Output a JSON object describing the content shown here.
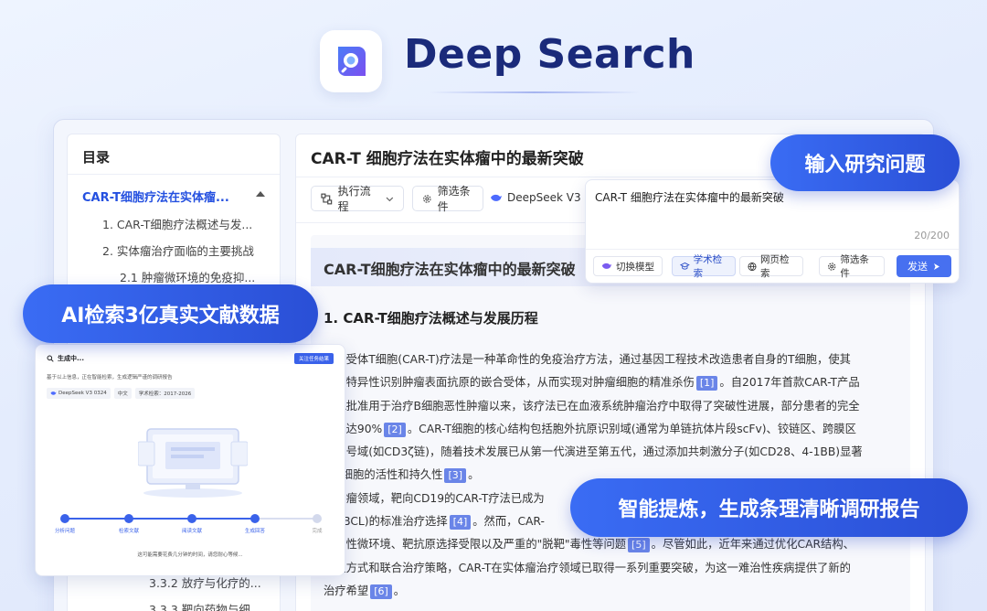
{
  "header": {
    "title": "Deep Search"
  },
  "toc": {
    "heading": "目录",
    "active": "CAR-T细胞疗法在实体瘤...",
    "items": [
      "1.   CAR-T细胞疗法概述与发...",
      "2.   实体瘤治疗面临的主要挑战",
      "2.1   肿瘤微环境的免疫抑..."
    ],
    "bottom_items": [
      "3.3.2 放疗与化疗的...",
      "3.3.3 靶向药物与细..."
    ]
  },
  "content": {
    "title": "CAR-T 细胞疗法在实体瘤中的最新突破",
    "toolbar": {
      "flow": "执行流程",
      "filter": "筛选条件",
      "model": "DeepSeek V3 03"
    },
    "report_title": "CAR-T细胞疗法在实体瘤中的最新突破",
    "section_heading": "1. CAR-T细胞疗法概述与发展历程",
    "para": [
      {
        "t": "抗原受体T细胞(CAR-T)疗法是一种革命性的免疫治疗方法，通过基因工程技术改造患者自身的T细胞，使其"
      },
      {
        "t": "能够特异性识别肿瘤表面抗原的嵌合受体，从而实现对肿瘤细胞的精准杀伤",
        "c": "[1]",
        "t2": "。自2017年首款CAR-T产品"
      },
      {
        "t": "FDA批准用于治疗B细胞恶性肿瘤以来，该疗法已在血液系统肿瘤治疗中取得了突破性进展，部分患者的完全"
      },
      {
        "t": "率高达90%",
        "c": "[2]",
        "t2": "。CAR-T细胞的核心结构包括胞外抗原识别域(通常为单链抗体片段scFv)、铰链区、跨膜区"
      },
      {
        "t": "内信号域(如CD3ζ链)，随着技术发展已从第一代演进至第五代，通过添加共刺激分子(如CD28、4-1BB)显著"
      },
      {
        "t": "了T细胞的活性和持久性",
        "c": "[3]",
        "t2": "。"
      },
      {
        "t": "液肿瘤领域，靶向CD19的CAR-T疗法已成为"
      },
      {
        "t": "(DLBCL)的标准治疗选择",
        "c": "[4]",
        "t2": "。然而，CAR-"
      },
      {
        "t": "抑制性微环境、靶抗原选择受限以及严重的\"脱靶\"毒性等问题",
        "c": "[5]",
        "t2": "。尽管如此，近年来通过优化CAR结构、"
      },
      {
        "t": "递送方式和联合治疗策略，CAR-T在实体瘤治疗领域已取得一系列重要突破，为这一难治性疾病提供了新的"
      },
      {
        "t": "治疗希望",
        "c": "[6]",
        "t2": "。"
      }
    ]
  },
  "chat": {
    "question": "CAR-T 细胞疗法在实体瘤中的最新突破",
    "count": "20/200",
    "chips": [
      "切换模型",
      "学术检索",
      "网页检索",
      "筛选条件"
    ],
    "send": "发送"
  },
  "pills": {
    "p1": "输入研究问题",
    "p2": "AI检索3亿真实文献数据",
    "p3": "智能提炼，生成条理清晰调研报告"
  },
  "card": {
    "status": "生成中...",
    "button": "关注任务结果",
    "desc": "基于以上信息，正在智能检索，生成逻辑严谨的调研报告",
    "tags": [
      "DeepSeek V3 0324",
      "中文",
      "学术检索：2017-2026"
    ],
    "steps": [
      "分析问题",
      "检索文献",
      "阅读文献",
      "生成回答",
      "完成"
    ],
    "footer": "这可能需要花费几分钟的时间，请您耐心等候..."
  },
  "colors": {
    "accent": "#3a62ea",
    "brand_dark": "#1a2a7a",
    "cite": "#6a85e8"
  }
}
